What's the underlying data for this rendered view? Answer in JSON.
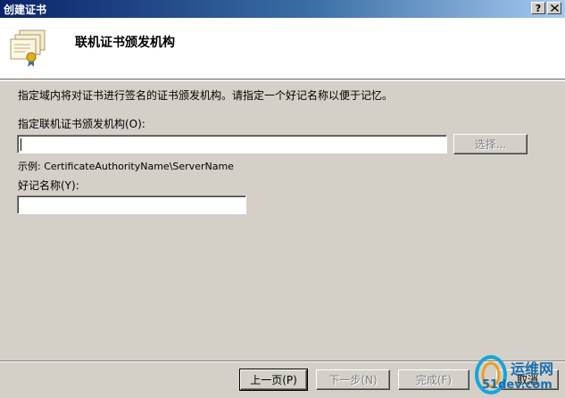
{
  "window": {
    "title": "创建证书",
    "help_glyph": "?",
    "close_glyph": "X"
  },
  "header": {
    "title": "联机证书颁发机构",
    "icon": "certificate-icon"
  },
  "body": {
    "description": "指定域内将对证书进行签名的证书颁发机构。请指定一个好记名称以便于记忆。",
    "ca_label": "指定联机证书颁发机构(O):",
    "ca_value": "",
    "select_button": "选择...",
    "example": "示例: CertificateAuthorityName\\ServerName",
    "friendly_label": "好记名称(Y):",
    "friendly_value": ""
  },
  "footer": {
    "prev_button": "上一页(P)",
    "next_button": "下一步(N)",
    "finish_button": "完成(F)",
    "cancel_button": "取消"
  },
  "watermark": {
    "text_cn": "运维网",
    "text_site": "51dev.com"
  }
}
